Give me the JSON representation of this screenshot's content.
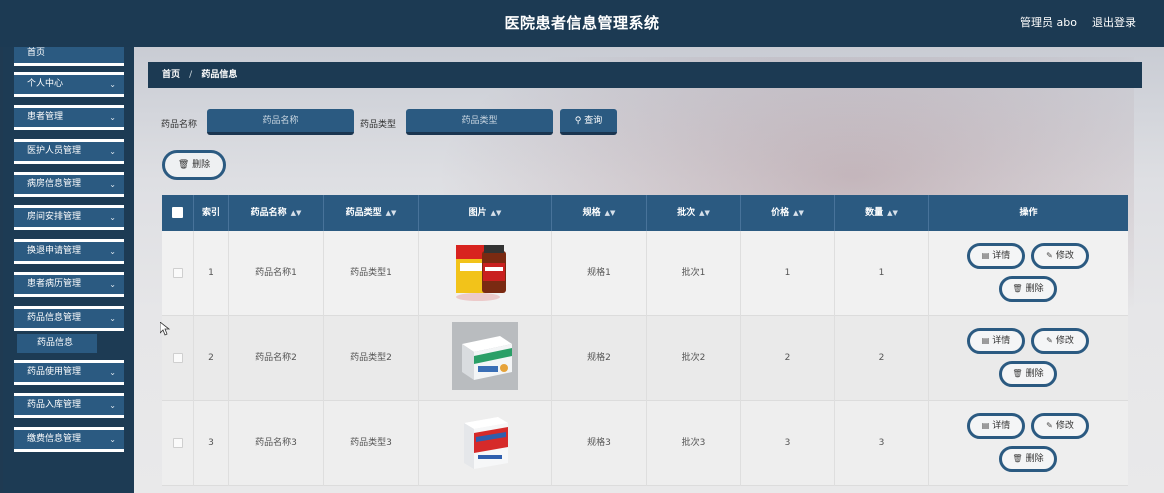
{
  "header": {
    "title": "医院患者信息管理系统",
    "user": "管理员 abo",
    "logout": "退出登录"
  },
  "sidebar": {
    "items": [
      {
        "label": "首页"
      },
      {
        "label": "个人中心"
      },
      {
        "label": "患者管理"
      },
      {
        "label": "医护人员管理"
      },
      {
        "label": "病房信息管理"
      },
      {
        "label": "房间安排管理"
      },
      {
        "label": "换退申请管理"
      },
      {
        "label": "患者病历管理"
      },
      {
        "label": "药品信息管理"
      },
      {
        "label": "药品使用管理"
      },
      {
        "label": "药品入库管理"
      },
      {
        "label": "缴费信息管理"
      }
    ],
    "submenu": {
      "label": "药品信息"
    }
  },
  "breadcrumb": {
    "home": "首页",
    "sep": "/",
    "current": "药品信息"
  },
  "search": {
    "name_label": "药品名称",
    "name_placeholder": "药品名称",
    "type_label": "药品类型",
    "type_placeholder": "药品类型",
    "query_label": "查询"
  },
  "toolbar": {
    "delete_label": "删除"
  },
  "table": {
    "headers": {
      "index": "索引",
      "name": "药品名称",
      "type": "药品类型",
      "image": "图片",
      "spec": "规格",
      "batch": "批次",
      "price": "价格",
      "quantity": "数量",
      "actions": "操作"
    },
    "rows": [
      {
        "index": "1",
        "name": "药品名称1",
        "type": "药品类型1",
        "spec": "规格1",
        "batch": "批次1",
        "price": "1",
        "quantity": "1"
      },
      {
        "index": "2",
        "name": "药品名称2",
        "type": "药品类型2",
        "spec": "规格2",
        "batch": "批次2",
        "price": "2",
        "quantity": "2"
      },
      {
        "index": "3",
        "name": "药品名称3",
        "type": "药品类型3",
        "spec": "规格3",
        "batch": "批次3",
        "price": "3",
        "quantity": "3"
      }
    ],
    "actions": {
      "detail": "详情",
      "edit": "修改",
      "delete": "删除"
    }
  },
  "colors": {
    "header_bg": "#1c3a53",
    "accent": "#2b5a81",
    "sidebar_bg": "#1d3b54"
  }
}
